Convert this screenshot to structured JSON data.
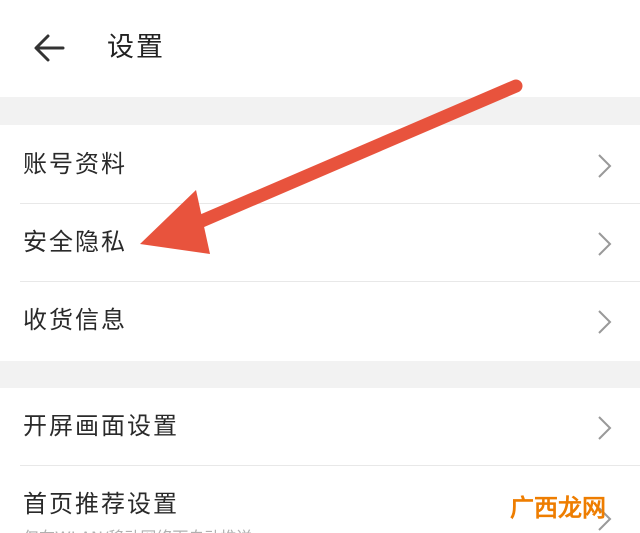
{
  "header": {
    "title": "设置"
  },
  "menu": {
    "items": [
      {
        "label": "账号资料"
      },
      {
        "label": "安全隐私"
      },
      {
        "label": "收货信息"
      },
      {
        "label": "开屏画面设置"
      },
      {
        "label": "首页推荐设置",
        "sublabel": "仅在WLAN/移动网络下自动推送"
      }
    ]
  },
  "annotation": {
    "arrow_color": "#e8533d"
  },
  "watermark": {
    "text": "广西龙网"
  },
  "colors": {
    "background_gap": "#f2f2f2",
    "text": "#2a2a2a",
    "chevron": "#999999"
  }
}
